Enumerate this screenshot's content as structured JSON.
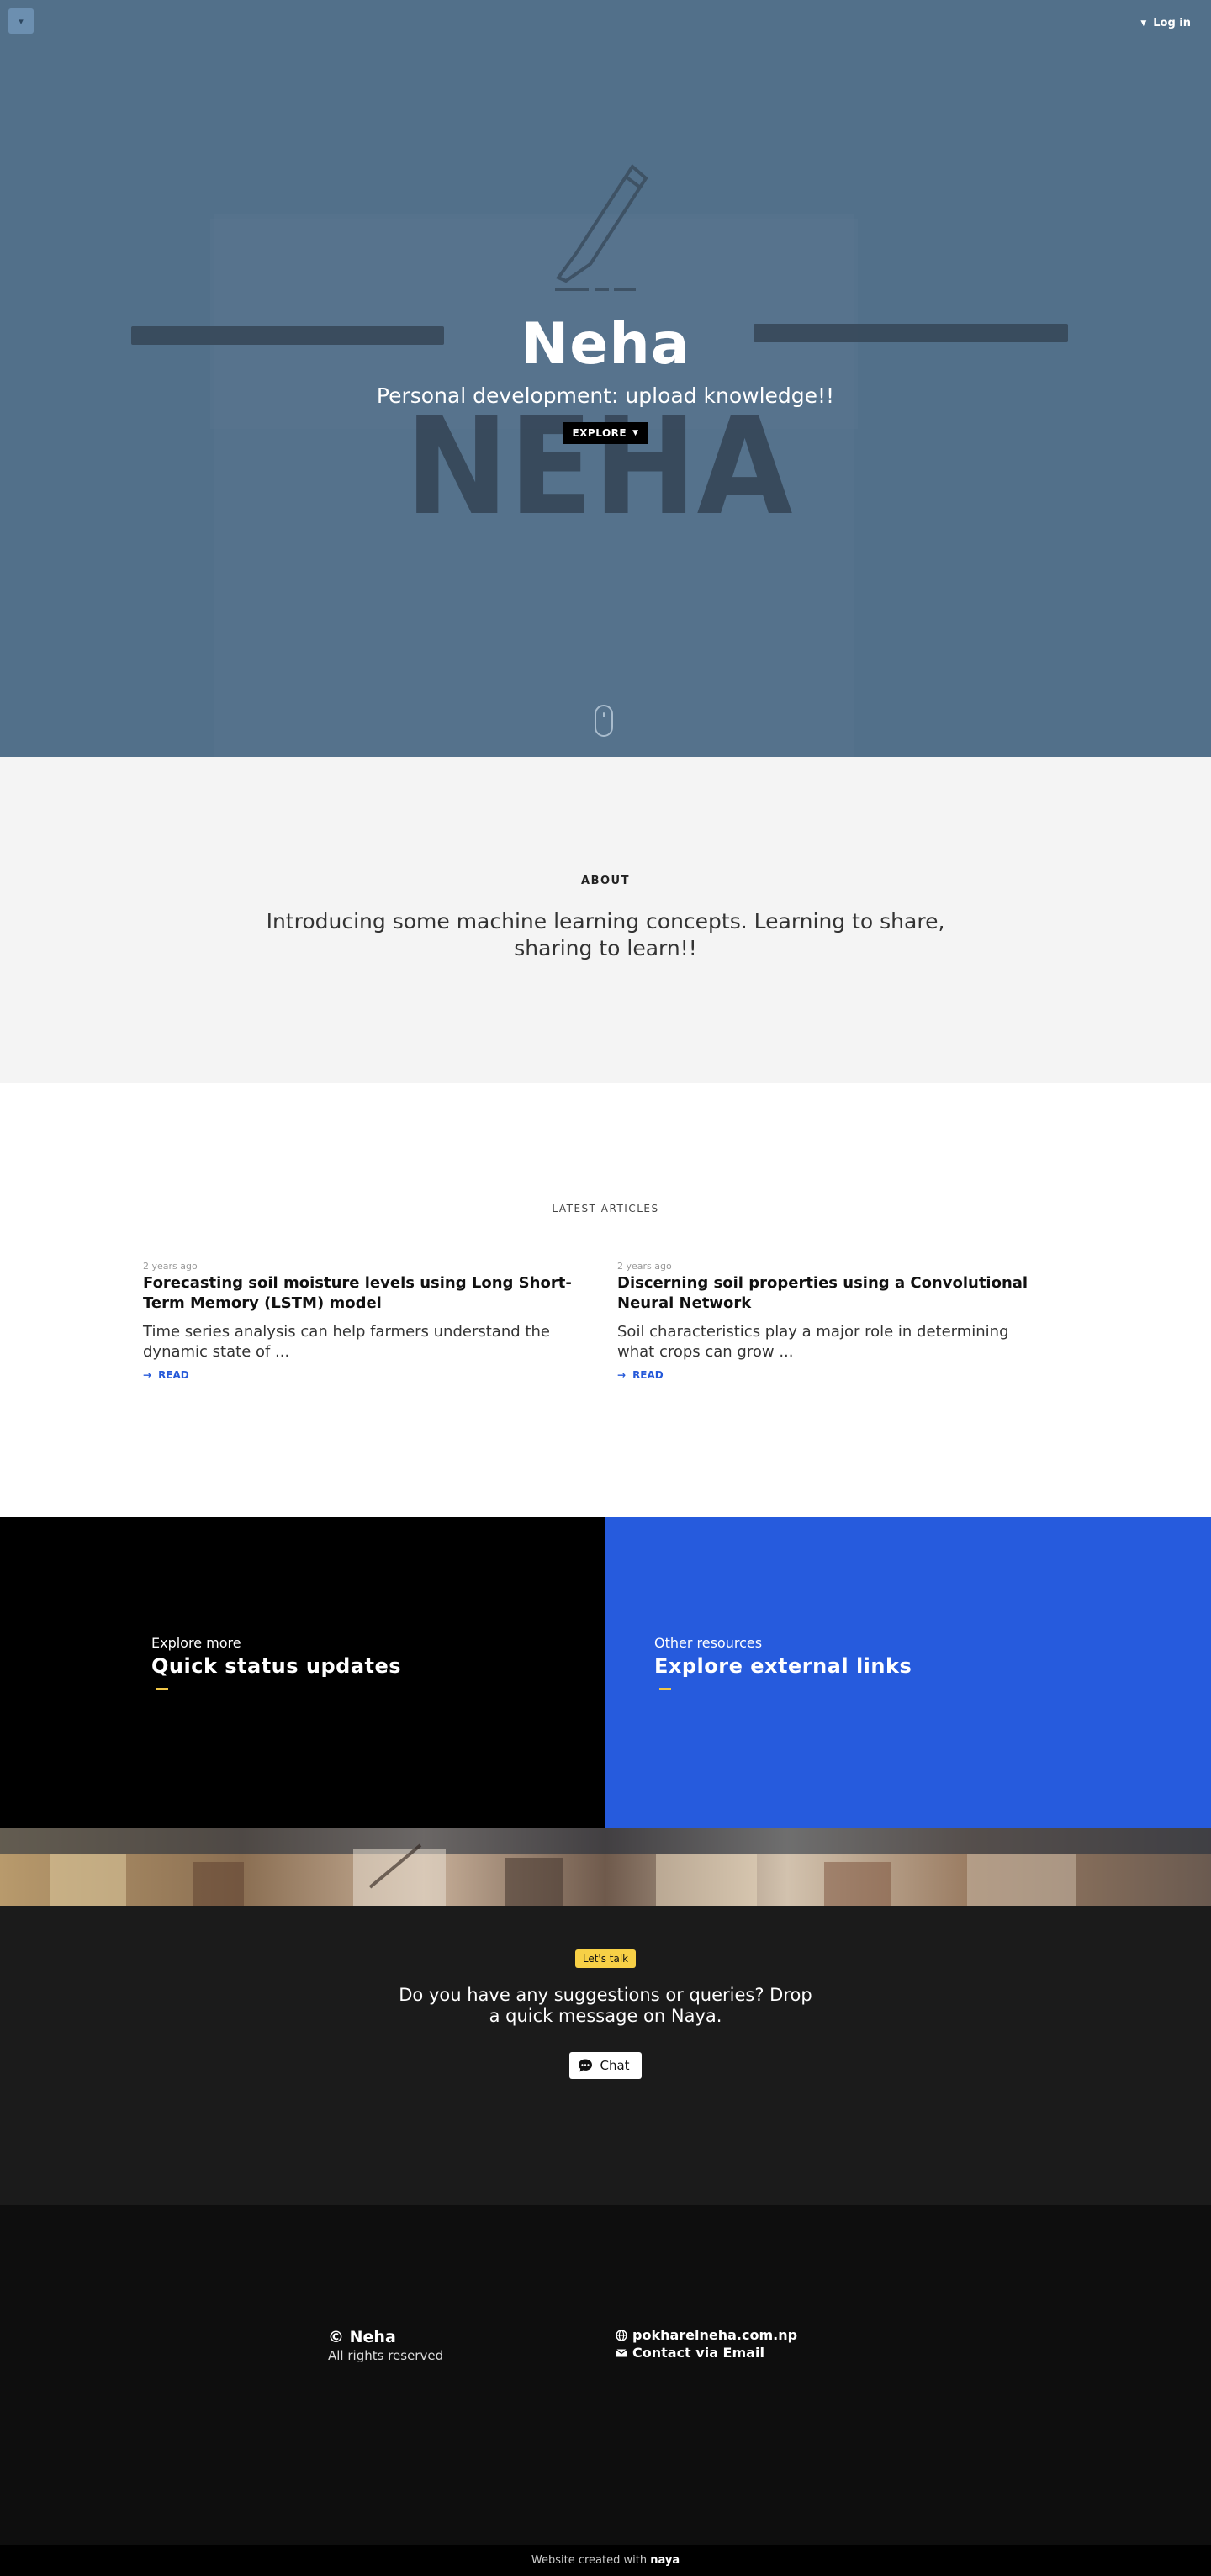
{
  "header": {
    "menu_icon": "chevron-down-icon",
    "login_label": "Log in"
  },
  "hero": {
    "title": "Neha",
    "tagline": "Personal development: upload knowledge!!",
    "explore_label": "EXPLORE",
    "logo_text": "NEHA"
  },
  "about": {
    "label": "ABOUT",
    "text": "Introducing some machine learning concepts. Learning to share, sharing to learn!!"
  },
  "articles": {
    "label": "LATEST ARTICLES",
    "items": [
      {
        "time": "2 years ago",
        "title": "Forecasting soil moisture levels using Long Short-Term Memory (LSTM) model",
        "excerpt": "Time series analysis can help farmers understand the dynamic state of ...",
        "read_label": "READ"
      },
      {
        "time": "2 years ago",
        "title": "Discerning soil properties using a Convolutional Neural Network",
        "excerpt": "Soil characteristics play a major role in determining what crops can grow ...",
        "read_label": "READ"
      }
    ]
  },
  "split": {
    "left": {
      "kicker": "Explore more",
      "heading": "Quick status updates"
    },
    "right": {
      "kicker": "Other resources",
      "heading": "Explore external links"
    }
  },
  "contact": {
    "badge": "Let's talk",
    "message": "Do you have any suggestions or queries? Drop a quick message on Naya.",
    "chat_label": "Chat"
  },
  "footer": {
    "brand": "Neha",
    "copyright_symbol": "©",
    "rights": "All rights reserved",
    "website": "pokharelneha.com.np",
    "email_label": "Contact via Email"
  },
  "credit": {
    "prefix": "Website created with",
    "brand": "naya"
  },
  "colors": {
    "hero_bg": "#52708a",
    "about_bg": "#f4f4f4",
    "accent_blue": "#265bdd",
    "accent_yellow": "#f7d046",
    "contact_bg": "#1b1b1b",
    "footer_bg": "#0e0e0e"
  }
}
